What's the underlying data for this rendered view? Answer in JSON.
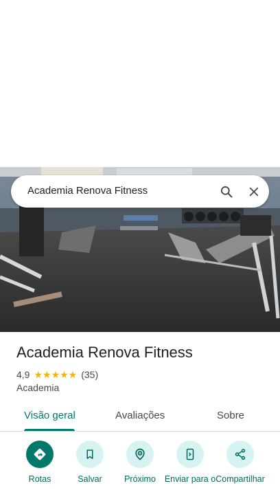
{
  "search": {
    "query": "Academia Renova Fitness"
  },
  "place": {
    "name": "Academia Renova Fitness",
    "rating": "4,9",
    "stars": "★★★★★",
    "review_count": "(35)",
    "category": "Academia"
  },
  "tabs": [
    {
      "label": "Visão geral",
      "active": true
    },
    {
      "label": "Avaliações",
      "active": false
    },
    {
      "label": "Sobre",
      "active": false
    }
  ],
  "actions": [
    {
      "label": "Rotas",
      "icon": "directions-icon"
    },
    {
      "label": "Salvar",
      "icon": "bookmark-icon"
    },
    {
      "label": "Próximo",
      "icon": "nearby-icon"
    },
    {
      "label": "Enviar para o",
      "icon": "send-to-phone-icon"
    },
    {
      "label": "Compartilhar",
      "icon": "share-icon"
    }
  ],
  "colors": {
    "accent": "#00796b",
    "action_bg": "#d6f3f2",
    "star": "#f4b400"
  }
}
